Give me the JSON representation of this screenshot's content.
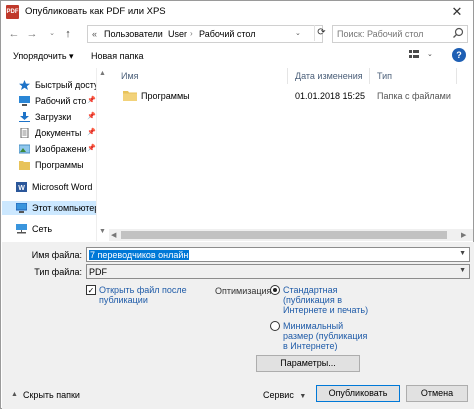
{
  "window": {
    "title": "Опубликовать как PDF или XPS",
    "app_icon_text": "PDF",
    "close_glyph": "✕"
  },
  "address": {
    "back_glyph": "←",
    "forward_glyph": "→",
    "up_glyph": "↑",
    "crumb_root_glyph": "«",
    "crumbs": [
      "Пользователи",
      "User",
      "Рабочий стол"
    ],
    "separator": "›",
    "refresh_glyph": "⟳",
    "dropdown_glyph": "⌄"
  },
  "search": {
    "placeholder": "Поиск: Рабочий стол",
    "icon": "search-icon"
  },
  "toolbar": {
    "organize_label": "Упорядочить ▾",
    "new_folder_label": "Новая папка",
    "help_glyph": "?"
  },
  "nav": {
    "items": [
      {
        "label": "Быстрый доступ",
        "icon": "star-icon",
        "pinned": false
      },
      {
        "label": "Рабочий сто",
        "icon": "desktop-icon",
        "pinned": true
      },
      {
        "label": "Загрузки",
        "icon": "download-icon",
        "pinned": true
      },
      {
        "label": "Документы",
        "icon": "documents-icon",
        "pinned": true
      },
      {
        "label": "Изображени",
        "icon": "pictures-icon",
        "pinned": true
      },
      {
        "label": "Программы",
        "icon": "folder-icon",
        "pinned": false
      },
      {
        "label": "Microsoft Word",
        "icon": "word-icon",
        "pinned": false
      },
      {
        "label": "Этот компьютер",
        "icon": "computer-icon",
        "pinned": false
      },
      {
        "label": "Сеть",
        "icon": "network-icon",
        "pinned": false
      }
    ]
  },
  "files": {
    "columns": [
      "Имя",
      "Дата изменения",
      "Тип"
    ],
    "rows": [
      {
        "name": "Программы",
        "date": "01.01.2018 15:25",
        "type": "Папка с файлами"
      }
    ]
  },
  "form": {
    "filename_label": "Имя файла:",
    "filename_value": "7 переводчиков онлайн",
    "filetype_label": "Тип файла:",
    "filetype_value": "PDF",
    "open_after_label_1": "Открыть файл после",
    "open_after_label_2": "публикации",
    "open_after_checked": true,
    "check_glyph": "✓",
    "optimize_label": "Оптимизация:",
    "optimize_standard_1": "Стандартная",
    "optimize_standard_2": "(публикация в",
    "optimize_standard_3": "Интернете и печать)",
    "optimize_min_1": "Минимальный",
    "optimize_min_2": "размер (публикация",
    "optimize_min_3": "в Интернете)",
    "selected_optimization": "standard",
    "params_button": "Параметры..."
  },
  "footer": {
    "hide_folders": "Скрыть папки",
    "hide_glyph": "▲",
    "service_button": "Сервис",
    "publish_button": "Опубликовать",
    "cancel_button": "Отмена"
  },
  "colors": {
    "accent": "#0078d7",
    "link_text": "#1f5ba8",
    "selected_nav": "#cce8ff",
    "pdf_icon": "#c0392b",
    "folder": "#e8c35a"
  }
}
